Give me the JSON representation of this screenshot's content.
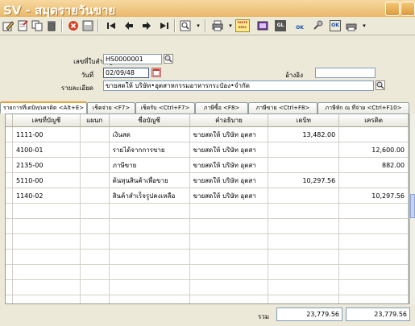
{
  "window": {
    "title": "SV - สมุดรายวันขาย"
  },
  "toolbar": {
    "icons": [
      "edit-icon",
      "new-document-icon",
      "copy-icon",
      "trash-icon",
      "cancel-icon",
      "save-icon",
      "first-icon",
      "prev-icon",
      "next-icon",
      "last-icon",
      "search-icon",
      "print-icon",
      "paste-icon",
      "film-icon",
      "gl-icon",
      "ok-icon",
      "tool-icon",
      "ok-icon-2"
    ],
    "paste_label": "PASTE DESC",
    "gl_label": "GL",
    "ok_label": "OK"
  },
  "form": {
    "doc_no_label": "เลขที่ใบสำคัญ",
    "doc_no": "HS0000001",
    "date_label": "วันที่",
    "date": "02/09/48",
    "ref_label": "อ้างอิง",
    "ref": "",
    "detail_label": "รายละเอียด",
    "detail": "ขายสดให้      บริษัท•อุตสาหกรรมอาหารกระป๋อง•จำกัด"
  },
  "tabs": [
    "รายการที่เดบิท/เครดิต <Alt+E>",
    "เช็คจ่าย <F7>",
    "เช็ครับ <Ctrl+F7>",
    "ภาษีซื้อ <F8>",
    "ภาษีขาย <Ctrl+F8>",
    "ภาษีหัก ณ ที่จ่าย <Ctrl+F10>"
  ],
  "table": {
    "headers": [
      "เลขที่บัญชี",
      "แผนก",
      "ชื่อบัญชี",
      "คำอธิบาย",
      "เดบิท",
      "เครดิต"
    ],
    "rows": [
      [
        "1111-00",
        "",
        "เงินสด",
        "ขายสดให้    บริษัท อุตสา",
        "13,482.00",
        ""
      ],
      [
        "4100-01",
        "",
        "รายได้จากการขาย",
        "ขายสดให้    บริษัท อุตสา",
        "",
        "12,600.00"
      ],
      [
        "2135-00",
        "",
        "ภาษีขาย",
        "ขายสดให้    บริษัท อุตสา",
        "",
        "882.00"
      ],
      [
        "5110-00",
        "",
        "ต้นทุนสินค้าเพื่อขาย",
        "ขายสดให้    บริษัท อุตสา",
        "10,297.56",
        ""
      ],
      [
        "1140-02",
        "",
        "สินค้าสำเร็จรูปคงเหลือ",
        "ขายสดให้    บริษัท อุตสา",
        "",
        "10,297.56"
      ]
    ]
  },
  "totals": {
    "label": "รวม",
    "debit": "23,779.56",
    "credit": "23,779.56"
  }
}
